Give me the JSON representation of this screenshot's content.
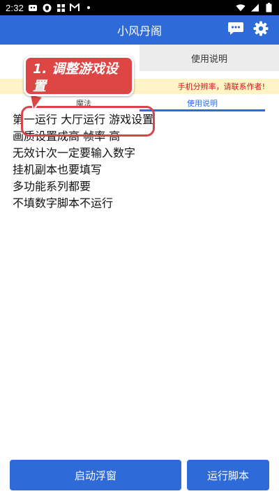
{
  "status_bar": {
    "time": "2:32"
  },
  "header": {
    "title": "小风丹阁"
  },
  "tabs": {
    "usage_label": "使用说明"
  },
  "warning": {
    "text": "手机分辨率，请联系作者!"
  },
  "sub_tabs": {
    "magic_label": "魔法",
    "usage_label": "使用说明"
  },
  "instructions": [
    "第一运行 大厅运行 游戏设置",
    "画质设置成高 帧率 高",
    "无效计次一定要输入数字",
    "挂机副本也要填写",
    "多功能系列都要",
    "不填数字脚本不运行"
  ],
  "callout": {
    "line1": "1. 调整游戏设",
    "line2": "置"
  },
  "buttons": {
    "float_window": "启动浮窗",
    "run_script": "运行脚本"
  },
  "colors": {
    "primary": "#2e6ad8",
    "warning_bg": "#fff4c6",
    "warning_text": "#d0181d",
    "annotation": "#de4545"
  }
}
